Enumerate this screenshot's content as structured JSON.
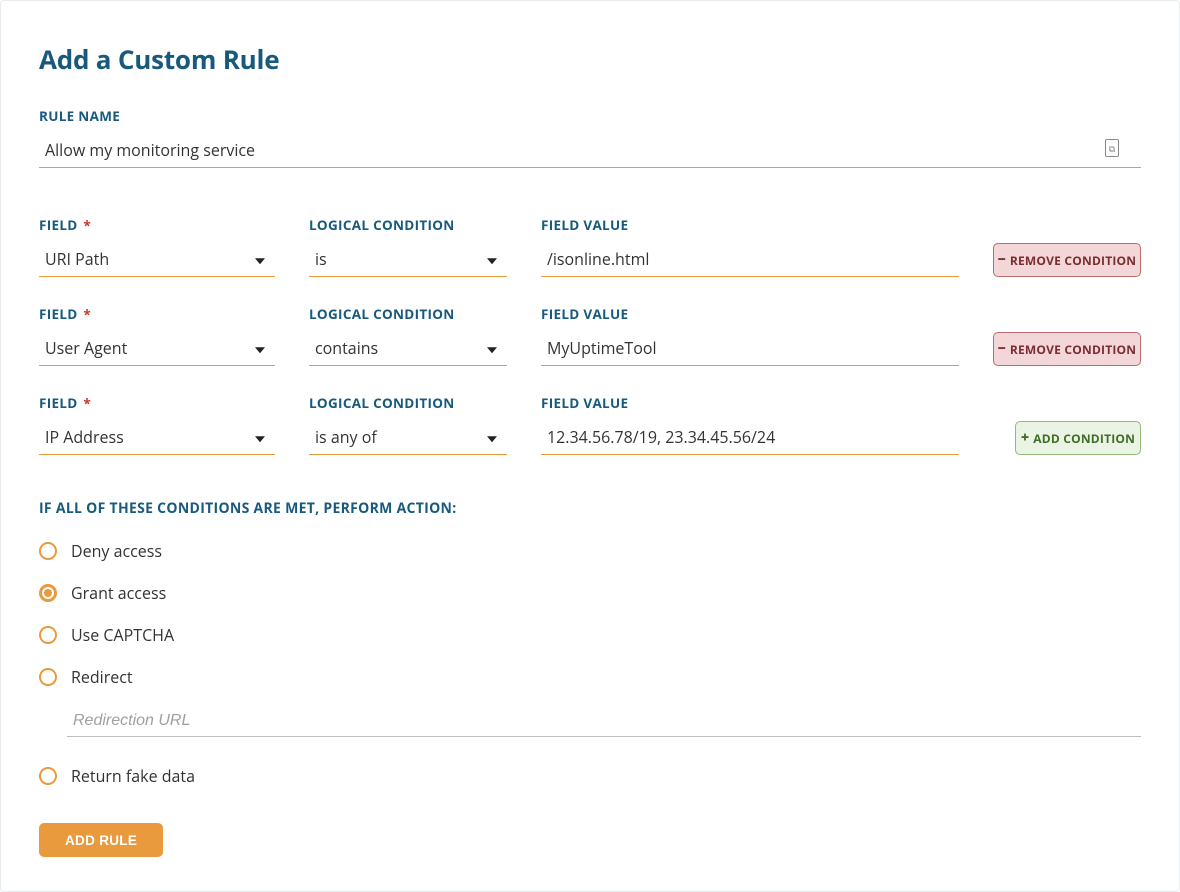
{
  "title": "Add a Custom Rule",
  "ruleName": {
    "label": "RULE NAME",
    "value": "Allow my monitoring service"
  },
  "condLabels": {
    "field": "FIELD",
    "logical": "LOGICAL CONDITION",
    "value": "FIELD VALUE",
    "required": "*"
  },
  "conditions": [
    {
      "field": "URI Path",
      "logical": "is",
      "value": "/isonline.html",
      "btn": "remove"
    },
    {
      "field": "User Agent",
      "logical": "contains",
      "value": "MyUptimeTool",
      "btn": "remove"
    },
    {
      "field": "IP Address",
      "logical": "is any of",
      "value": "12.34.56.78/19, 23.34.45.56/24",
      "btn": "add"
    }
  ],
  "buttons": {
    "remove": "REMOVE CONDITION",
    "addCond": "ADD CONDITION",
    "addRule": "ADD RULE"
  },
  "actions": {
    "heading": "IF ALL OF THESE CONDITIONS ARE MET, PERFORM ACTION:",
    "items": [
      {
        "label": "Deny access",
        "checked": false
      },
      {
        "label": "Grant access",
        "checked": true
      },
      {
        "label": "Use CAPTCHA",
        "checked": false
      },
      {
        "label": "Redirect",
        "checked": false
      },
      {
        "label": "Return fake data",
        "checked": false
      }
    ],
    "redirectPlaceholder": "Redirection URL"
  }
}
